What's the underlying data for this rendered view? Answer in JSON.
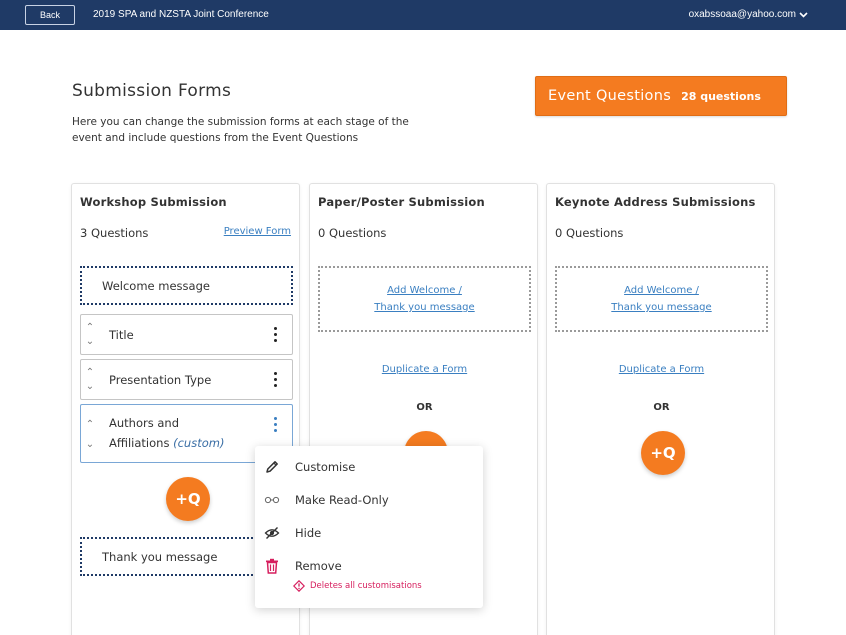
{
  "header": {
    "back_label": "Back",
    "conference_title": "2019 SPA and NZSTA Joint Conference",
    "user_email": "oxabssoaa@yahoo.com"
  },
  "page": {
    "title": "Submission Forms",
    "description": "Here you can change the submission forms at each stage of the event and include questions from the Event Questions"
  },
  "event_questions": {
    "label": "Event Questions",
    "count": "28 questions"
  },
  "cards": [
    {
      "title": "Workshop Submission",
      "count": "3 Questions",
      "preview_label": "Preview Form",
      "welcome": "Welcome message",
      "questions": [
        {
          "label": "Title"
        },
        {
          "label": "Presentation Type"
        },
        {
          "label_line1": "Authors and",
          "label_line2": "Affiliations",
          "tag": "(custom)"
        }
      ],
      "add_question": "+Q",
      "thank_you": "Thank you message"
    },
    {
      "title": "Paper/Poster Submission",
      "count": "0 Questions",
      "add_welcome_line1": "Add Welcome /",
      "add_welcome_line2": "Thank you message",
      "duplicate": "Duplicate a Form",
      "or": "OR",
      "add_question": "+Q"
    },
    {
      "title": "Keynote Address Submissions",
      "count": "0 Questions",
      "add_welcome_line1": "Add Welcome /",
      "add_welcome_line2": "Thank you message",
      "duplicate": "Duplicate a Form",
      "or": "OR",
      "add_question": "+Q"
    }
  ],
  "context_menu": {
    "items": [
      {
        "label": "Customise",
        "icon": "pencil-icon"
      },
      {
        "label": "Make Read-Only",
        "icon": "glasses-icon"
      },
      {
        "label": "Hide",
        "icon": "eye-slash-icon"
      },
      {
        "label": "Remove",
        "icon": "trash-icon"
      }
    ],
    "warning": "Deletes all customisations"
  },
  "colors": {
    "header_bg": "#1f3a66",
    "accent_orange": "#f47b20",
    "link_blue": "#3a7fc1",
    "danger": "#d61f5e"
  }
}
